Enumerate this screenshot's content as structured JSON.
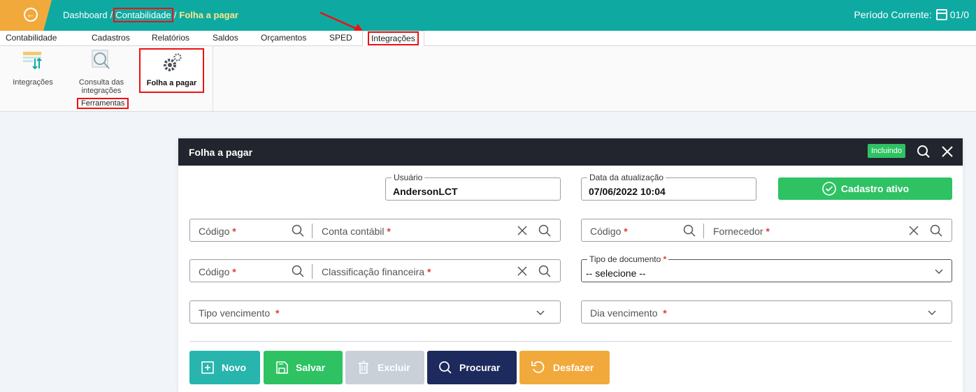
{
  "breadcrumb": {
    "items": [
      "Dashboard",
      "Contabilidade",
      "Folha a pagar"
    ],
    "separator": "/"
  },
  "periodo": {
    "label": "Período Corrente:",
    "value": "01/0"
  },
  "menu": {
    "tabs": [
      "Contabilidade",
      "Cadastros",
      "Relatórios",
      "Saldos",
      "Orçamentos",
      "SPED",
      "Integrações"
    ],
    "active": "Integrações"
  },
  "ribbon": {
    "buttons": [
      {
        "label": "Integrações",
        "icon": "table-sort-icon"
      },
      {
        "label": "Consulta das integrações",
        "label_line1": "Consulta das",
        "label_line2": "integrações",
        "icon": "magnifier-icon"
      },
      {
        "label": "Folha a pagar",
        "icon": "gears-icon"
      }
    ],
    "group_label": "Ferramentas"
  },
  "dialog": {
    "title": "Folha a pagar",
    "status_badge": "Incluindo",
    "usuario": {
      "label": "Usuário",
      "value": "AndersonLCT"
    },
    "data_atualizacao": {
      "label": "Data da atualização",
      "value": "07/06/2022 10:04"
    },
    "cadastro_ativo": "Cadastro ativo",
    "fields": {
      "codigo_conta": "Código",
      "conta_contabil": "Conta contábil",
      "codigo_fornecedor": "Código",
      "fornecedor": "Fornecedor",
      "codigo_classificacao": "Código",
      "classificacao_financeira": "Classificação financeira",
      "tipo_documento_label": "Tipo de documento",
      "tipo_documento_value": "-- selecione --",
      "tipo_vencimento": "Tipo vencimento",
      "dia_vencimento": "Dia vencimento",
      "required_mark": "*"
    },
    "actions": {
      "novo": "Novo",
      "salvar": "Salvar",
      "excluir": "Excluir",
      "procurar": "Procurar",
      "desfazer": "Desfazer"
    }
  },
  "colors": {
    "topbar": "#0eaaa2",
    "back": "#f2a93b",
    "dialog_header": "#22252d",
    "green": "#2ec263",
    "teal": "#27b5ad",
    "gray_disabled": "#c9d0d8",
    "navy": "#1c2a5e",
    "orange": "#f2a93b",
    "highlight": "#ee1111"
  }
}
